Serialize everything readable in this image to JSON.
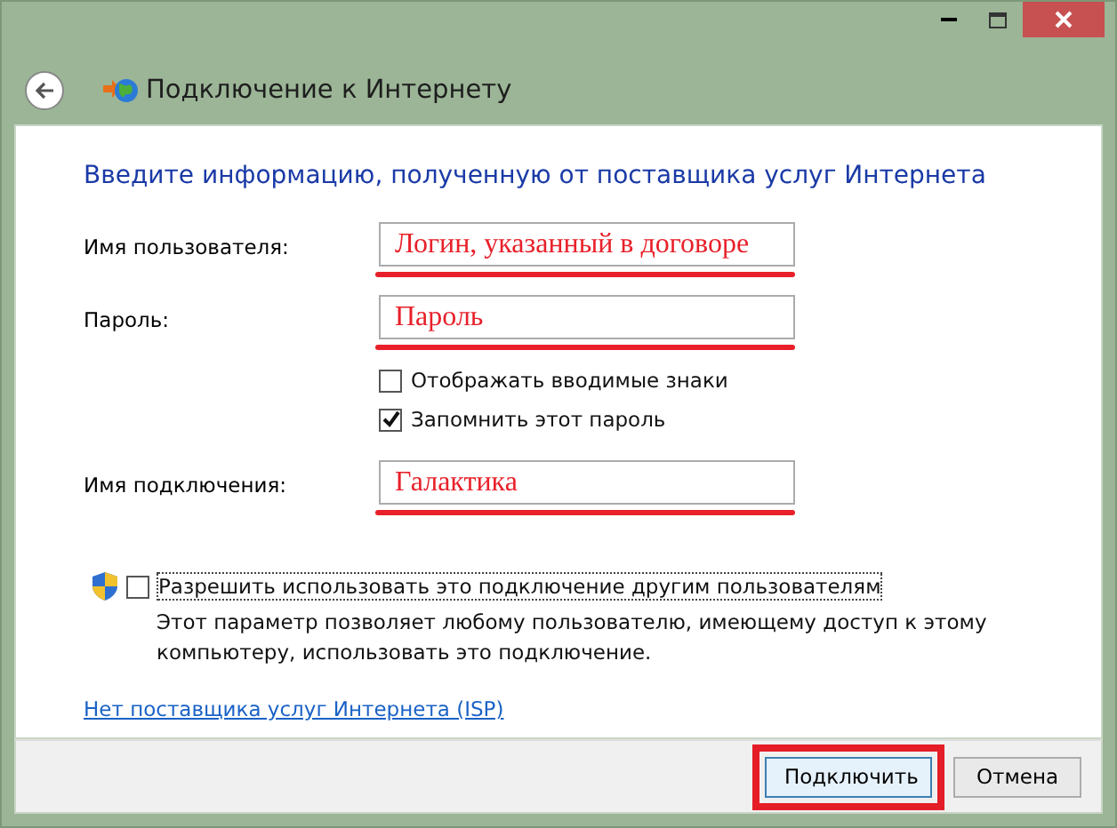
{
  "window": {
    "title": "Подключение к Интернету",
    "close_hover": true
  },
  "heading": "Введите информацию, полученную от поставщика услуг Интернета",
  "rows": [
    {
      "kind": "field",
      "label": "Имя пользователя:",
      "value": "Логин, указанный в договоре",
      "underlined": true
    },
    {
      "kind": "field",
      "label": "Пароль:",
      "value": "Пароль",
      "underlined": true
    },
    {
      "kind": "checkbox",
      "label": "Отображать вводимые знаки",
      "checked": false
    },
    {
      "kind": "checkbox",
      "label": "Запомнить этот пароль",
      "checked": true
    },
    {
      "kind": "field",
      "label": "Имя подключения:",
      "value": "Галактика",
      "underlined": true
    }
  ],
  "share": {
    "label": "Разрешить использовать это подключение другим пользователям",
    "checked": false,
    "description": "Этот параметр позволяет любому пользователю, имеющему доступ к этому компьютеру, использовать это подключение."
  },
  "link": "Нет поставщика услуг Интернета (ISP)",
  "buttons": [
    {
      "label": "Подключить",
      "default": true,
      "highlighted": true
    },
    {
      "label": "Отмена",
      "default": false,
      "highlighted": false
    }
  ]
}
